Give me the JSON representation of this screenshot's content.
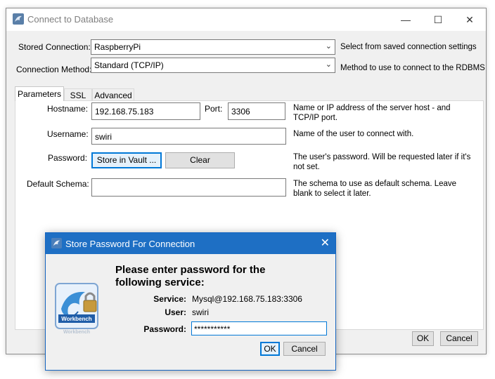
{
  "main_window": {
    "title": "Connect to Database",
    "controls": {
      "minimize": "—",
      "maximize": "☐",
      "close": "✕"
    }
  },
  "stored_connection": {
    "label": "Stored Connection:",
    "value": "RaspberryPi",
    "description": "Select from saved connection settings"
  },
  "connection_method": {
    "label": "Connection Method:",
    "value": "Standard (TCP/IP)",
    "description": "Method to use to connect to the RDBMS"
  },
  "tabs": [
    {
      "label": "Parameters"
    },
    {
      "label": "SSL"
    },
    {
      "label": "Advanced"
    }
  ],
  "parameters": {
    "hostname": {
      "label": "Hostname:",
      "value": "192.168.75.183"
    },
    "port": {
      "label": "Port:",
      "value": "3306"
    },
    "hostname_description": [
      "Name or IP address of the server host - and",
      "TCP/IP port."
    ],
    "username": {
      "label": "Username:",
      "value": "swiri",
      "description": "Name of the user to connect with."
    },
    "password": {
      "label": "Password:",
      "store_button": "Store in Vault ...",
      "clear_button": "Clear",
      "description": [
        "The user's password. Will be requested later if it's",
        "not set."
      ]
    },
    "default_schema": {
      "label": "Default Schema:",
      "value": "",
      "description": [
        "The schema to use as default schema. Leave",
        "blank to select it later."
      ]
    }
  },
  "footer": {
    "ok": "OK",
    "cancel": "Cancel"
  },
  "dialog": {
    "title": "Store Password For Connection",
    "close": "✕",
    "prompt": [
      "Please enter password for the",
      "following service:"
    ],
    "service_label": "Service:",
    "service_value": "Mysql@192.168.75.183:3306",
    "user_label": "User:",
    "user_value": "swiri",
    "password_label": "Password:",
    "password_value": "***********",
    "ok": "OK",
    "cancel": "Cancel",
    "logo_text": "MySQL Workbench",
    "logo_icon": "dolphin-lock-icon"
  },
  "colors": {
    "dialog_titlebar": "#1e6fc4",
    "focus_border": "#0078d7"
  }
}
